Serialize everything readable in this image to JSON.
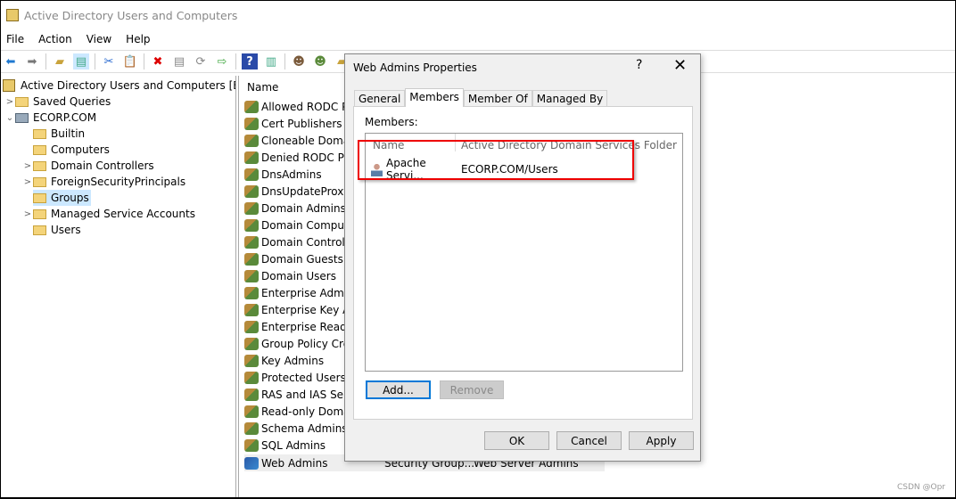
{
  "window": {
    "title": "Active Directory Users and Computers"
  },
  "menu": [
    "File",
    "Action",
    "View",
    "Help"
  ],
  "toolbar": [
    "back-icon",
    "forward-icon",
    "up-folder-icon",
    "show-console-tree-icon",
    "cut-icon",
    "paste-icon",
    "delete-icon",
    "properties-icon",
    "refresh-icon",
    "export-icon",
    "help-icon",
    "action-pane-icon",
    "new-user-icon",
    "new-group-icon",
    "new-ou-icon"
  ],
  "tree": [
    {
      "label": "Active Directory Users and Computers [E-RDC",
      "chev": "",
      "level": 0
    },
    {
      "label": "Saved Queries",
      "chev": ">",
      "level": 1
    },
    {
      "label": "ECORP.COM",
      "chev": "v",
      "level": 1
    },
    {
      "label": "Builtin",
      "chev": "",
      "level": 2
    },
    {
      "label": "Computers",
      "chev": "",
      "level": 2
    },
    {
      "label": "Domain Controllers",
      "chev": ">",
      "level": 2
    },
    {
      "label": "ForeignSecurityPrincipals",
      "chev": ">",
      "level": 2
    },
    {
      "label": "Groups",
      "chev": "",
      "level": 2,
      "selected": true
    },
    {
      "label": "Managed Service Accounts",
      "chev": ">",
      "level": 2
    },
    {
      "label": "Users",
      "chev": "",
      "level": 2
    }
  ],
  "list": {
    "header": "Name",
    "rows": [
      "Allowed RODC Pas",
      "Cert Publishers",
      "Cloneable Domain",
      "Denied RODC Pass",
      "DnsAdmins",
      "DnsUpdateProxy",
      "Domain Admins",
      "Domain Compute",
      "Domain Controlle",
      "Domain Guests",
      "Domain Users",
      "Enterprise Admins",
      "Enterprise Key Adr",
      "Enterprise Read-o",
      "Group Policy Crea",
      "Key Admins",
      "Protected Users",
      "RAS and IAS Serve",
      "Read-only Domair",
      "Schema Admins",
      "SQL Admins"
    ],
    "selected": {
      "name": "Web Admins",
      "type": "Security Group...",
      "description": "Web Server Admins"
    }
  },
  "dialog": {
    "title": "Web Admins Properties",
    "help": "?",
    "close": "✕",
    "tabs": [
      "General",
      "Members",
      "Member Of",
      "Managed By"
    ],
    "active_tab": "Members",
    "members_label": "Members:",
    "col_name": "Name",
    "col_folder": "Active Directory Domain Services Folder",
    "members": [
      {
        "name": "Apache Servi...",
        "folder": "ECORP.COM/Users"
      }
    ],
    "add": "Add...",
    "remove": "Remove",
    "ok": "OK",
    "cancel": "Cancel",
    "apply": "Apply"
  },
  "highlight_color": "#e00000",
  "watermark": "CSDN @Opr"
}
